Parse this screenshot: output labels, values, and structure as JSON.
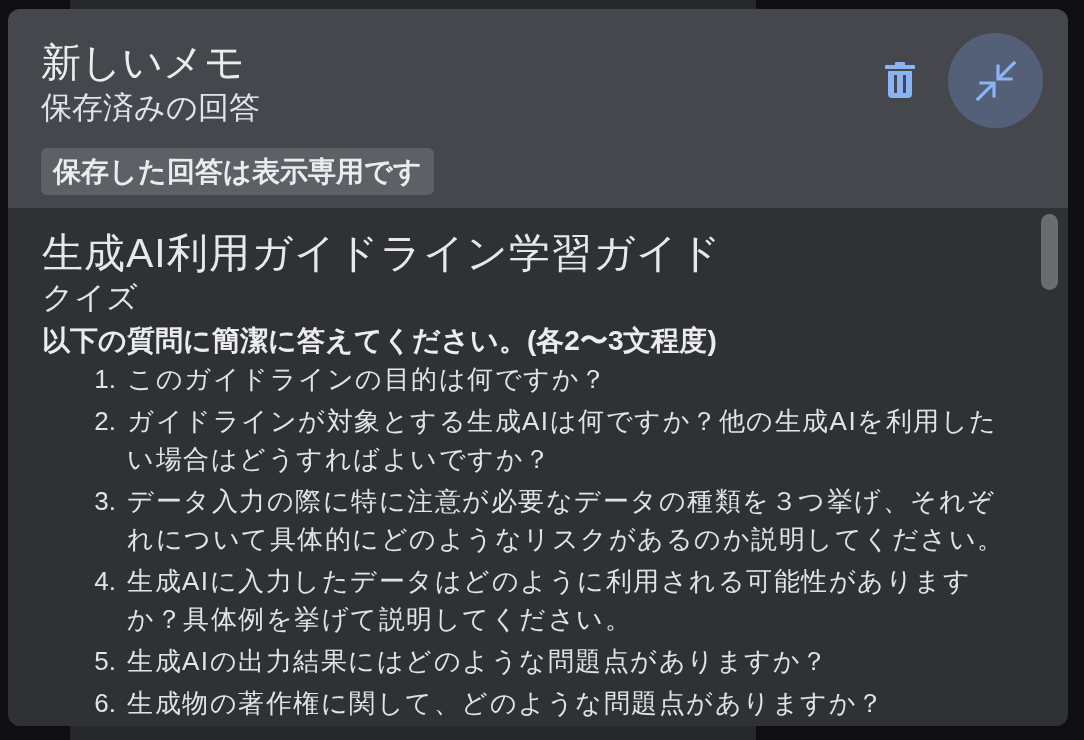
{
  "note": {
    "title": "新しいメモ",
    "subtitle": "保存済みの回答",
    "badge": "保存した回答は表示専用です"
  },
  "content": {
    "title": "生成AI利用ガイドライン学習ガイド",
    "section": "クイズ",
    "instruction": "以下の質問に簡潔に答えてください。(各2〜3文程度)",
    "questions": [
      {
        "number": "1.",
        "text": "このガイドラインの目的は何ですか？"
      },
      {
        "number": "2.",
        "text": "ガイドラインが対象とする生成AIは何ですか？他の生成AIを利用したい場合はどうすればよいですか？"
      },
      {
        "number": "3.",
        "text": "データ入力の際に特に注意が必要なデータの種類を３つ挙げ、それぞれについて具体的にどのようなリスクがあるのか説明してください。"
      },
      {
        "number": "4.",
        "text": "生成AIに入力したデータはどのように利用される可能性がありますか？具体例を挙げて説明してください。"
      },
      {
        "number": "5.",
        "text": "生成AIの出力結果にはどのような問題点がありますか？"
      },
      {
        "number": "6.",
        "text": "生成物の著作権に関して、どのような問題点がありますか？"
      }
    ]
  }
}
